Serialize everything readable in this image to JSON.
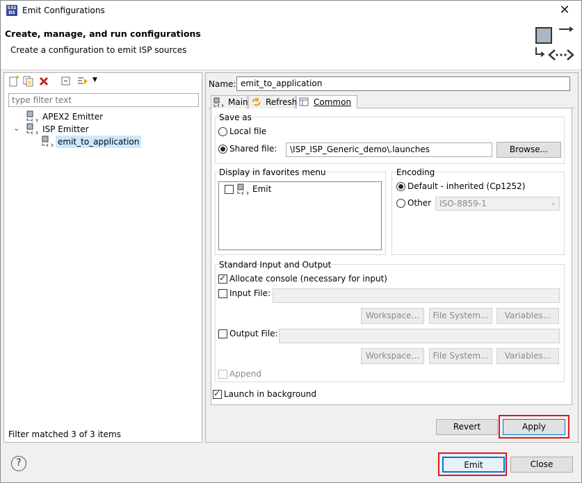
{
  "window": {
    "title": "Emit Configurations",
    "close_glyph": "✕",
    "icon_text": "S32 DS"
  },
  "header": {
    "title": "Create, manage, and run configurations",
    "subtitle": "Create a configuration to emit ISP sources"
  },
  "left": {
    "filter_placeholder": "type filter text",
    "tree": [
      {
        "label": "APEX2 Emitter"
      },
      {
        "label": "ISP Emitter",
        "expanded": true
      },
      {
        "label": "emit_to_application",
        "selected": true
      }
    ],
    "status": "Filter matched 3 of 3 items"
  },
  "right": {
    "name_label": "Name:",
    "name_value": "emit_to_application",
    "tabs": [
      {
        "label": "Main"
      },
      {
        "label": "Refresh"
      },
      {
        "label": "Common",
        "active": true
      }
    ],
    "save_as": {
      "title": "Save as",
      "local_label": "Local file",
      "shared_label": "Shared file:",
      "shared_value": "\\ISP_ISP_Generic_demo\\.launches",
      "browse_label": "Browse...",
      "selected": "shared"
    },
    "favorites": {
      "title": "Display in favorites menu",
      "item_label": "Emit",
      "checked": false
    },
    "encoding": {
      "title": "Encoding",
      "default_label": "Default - inherited (Cp1252)",
      "other_label": "Other",
      "other_value": "ISO-8859-1",
      "selected": "default"
    },
    "std_io": {
      "title": "Standard Input and Output",
      "allocate_label": "Allocate console (necessary for input)",
      "input_label": "Input File:",
      "output_label": "Output File:",
      "workspace_label": "Workspace...",
      "filesystem_label": "File System...",
      "variables_label": "Variables...",
      "append_label": "Append"
    },
    "launch_bg_label": "Launch in background",
    "revert_label": "Revert",
    "apply_label": "Apply"
  },
  "footer": {
    "help_glyph": "?",
    "emit_label": "Emit",
    "close_label": "Close"
  },
  "colors": {
    "highlight": "#e2151c",
    "selection": "#cce8ff"
  }
}
